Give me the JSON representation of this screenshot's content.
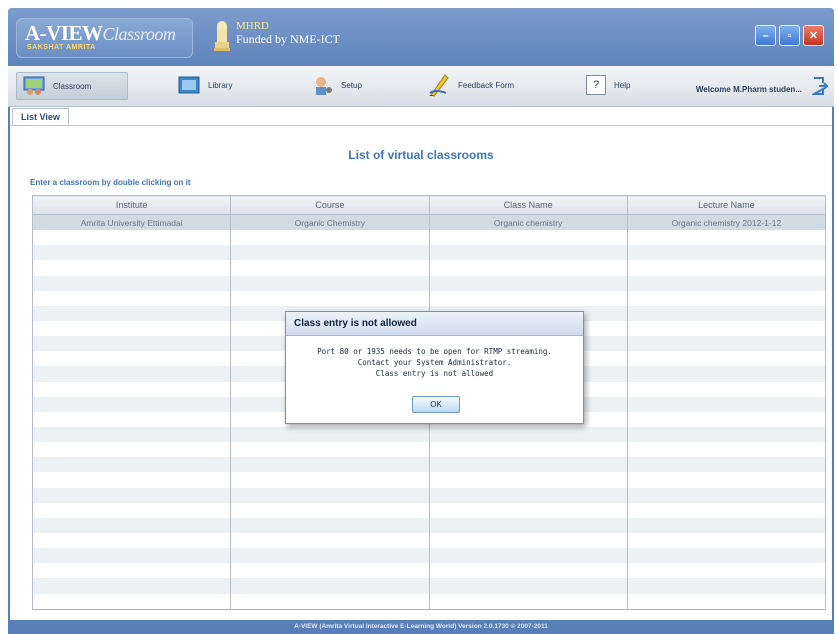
{
  "app": {
    "logo_main": "A-VIEW",
    "logo_script": "Classroom",
    "logo_sub": "SAKSHAT AMRITA",
    "ministry": "MHRD",
    "funded": "Funded by NME-ICT"
  },
  "toolbar": {
    "items": [
      {
        "label": "Classroom",
        "icon": "classroom-icon"
      },
      {
        "label": "Library",
        "icon": "library-icon"
      },
      {
        "label": "Setup",
        "icon": "setup-icon"
      },
      {
        "label": "Feedback Form",
        "icon": "feedback-icon"
      },
      {
        "label": "Help",
        "icon": "help-icon"
      }
    ],
    "welcome": "Welcome M.Pharm studen..."
  },
  "tabs": [
    {
      "label": "List View"
    }
  ],
  "main": {
    "title": "List of virtual classrooms",
    "hint": "Enter a classroom by double clicking on it"
  },
  "table": {
    "headers": [
      "Institute",
      "Course",
      "Class Name",
      "Lecture Name"
    ],
    "rows": [
      [
        "Amrita University Ettimadai",
        "Organic Chemistry",
        "Organic chemistry",
        "Organic chemistry 2012-1-12"
      ]
    ],
    "empty_rows": 25
  },
  "dialog": {
    "title": "Class entry is not allowed",
    "lines": [
      "Port 80 or 1935 needs to be open for RTMP streaming.",
      "Contact your System Administrator.",
      "Class entry is not allowed"
    ],
    "ok": "OK"
  },
  "footer": "A-VIEW (Amrita Virtual Interactive E-Learning World) Version 2.0.1730 © 2007-2011",
  "colors": {
    "frame": "#5a7fb8",
    "accent_text": "#3e76b8",
    "close_button": "#c8331f"
  }
}
